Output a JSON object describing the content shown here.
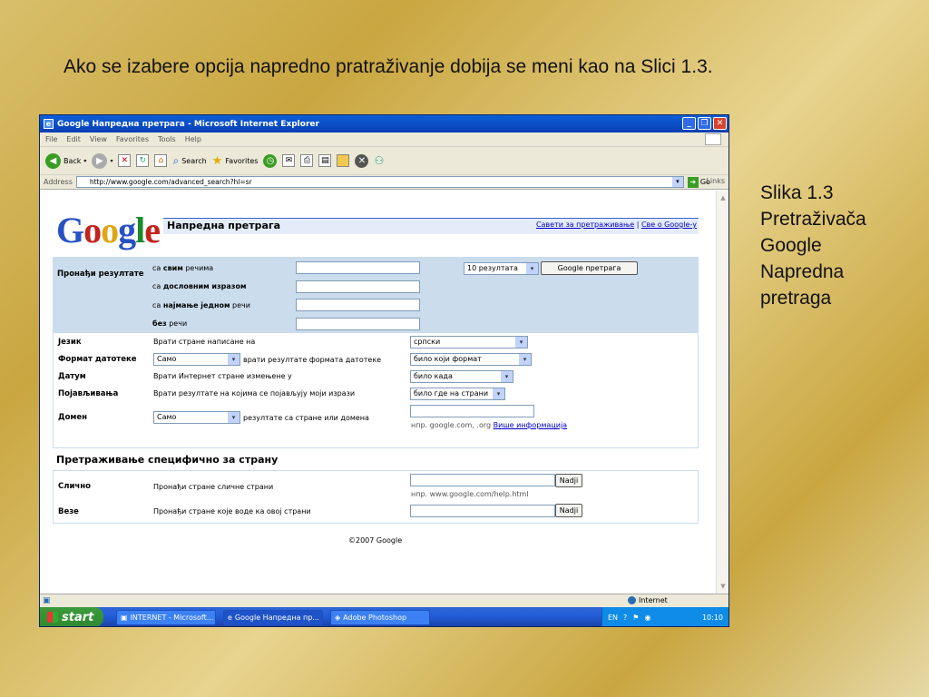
{
  "slide": {
    "title": "Ako se izabere opcija napredno pratraživanje dobija se meni kao na Slici 1.3.",
    "caption_lines": [
      "Slika 1.3",
      "Pretraživača",
      "Google",
      "Napredna",
      "pretraga"
    ]
  },
  "window": {
    "title": "Google Напредна претрага - Microsoft Internet Explorer",
    "menu": [
      "File",
      "Edit",
      "View",
      "Favorites",
      "Tools",
      "Help"
    ],
    "toolbar": {
      "back": "Back",
      "search": "Search",
      "favorites": "Favorites"
    },
    "address": {
      "label": "Address",
      "url": "http://www.google.com/advanced_search?hl=sr",
      "go": "Go",
      "links": "Links"
    }
  },
  "page": {
    "logo": "Google",
    "header_title": "Напредна претрага",
    "header_links": [
      "Савети за претраживање",
      "Све о Google-у"
    ],
    "find": {
      "label": "Пронађи резултате",
      "rows": [
        {
          "pre": "са ",
          "bold": "свим",
          "post": " речима"
        },
        {
          "pre": "са ",
          "bold": "дословним изразом",
          "post": ""
        },
        {
          "pre": "са ",
          "bold": "најмање једном",
          "post": " речи"
        },
        {
          "pre": "",
          "bold": "без",
          "post": " речи"
        }
      ],
      "results_select": "10 резултата",
      "search_button": "Google претрага"
    },
    "options": [
      {
        "label": "Језик",
        "desc": "Врати стране написане на",
        "select": "српски"
      },
      {
        "label": "Формат датотеке",
        "prefix_select": "Само",
        "desc": "врати резултате формата датотеке",
        "select": "било који формат"
      },
      {
        "label": "Датум",
        "desc": "Врати Интернет стране измењене у",
        "select": "било када"
      },
      {
        "label": "Појављивања",
        "desc": "Врати резултате на којима се појављују моји изрази",
        "select": "било где на страни"
      },
      {
        "label": "Домен",
        "prefix_select": "Само",
        "desc": "резултате са стране или домена",
        "hint": "нпр. google.com, .org",
        "hint_link": "Више информација"
      }
    ],
    "site_title": "Претраживање специфично за страну",
    "site_rows": [
      {
        "label": "Слично",
        "desc": "Пронађи стране сличне страни",
        "button": "Nadji",
        "hint": "нпр. www.google.com/help.html"
      },
      {
        "label": "Везе",
        "desc": "Пронађи стране које воде ка овој страни",
        "button": "Nadji"
      }
    ],
    "copyright": "©2007 Google"
  },
  "status": {
    "zone": "Internet"
  },
  "taskbar": {
    "start": "start",
    "tasks": [
      "INTERNET - Microsoft...",
      "Google Напредна пр...",
      "Adobe Photoshop"
    ],
    "lang": "EN",
    "clock": "10:10"
  }
}
